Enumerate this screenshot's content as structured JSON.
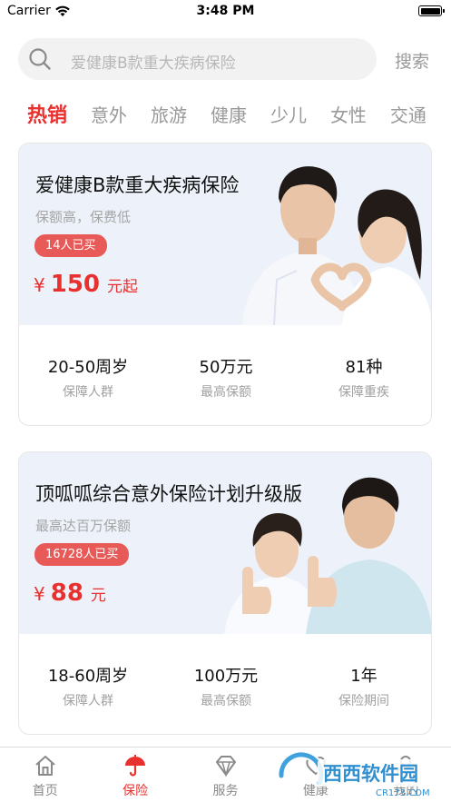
{
  "status_bar": {
    "carrier": "Carrier",
    "time": "3:48 PM"
  },
  "search": {
    "placeholder": "爱健康B款重大疾病保险",
    "button_label": "搜索"
  },
  "tabs": [
    {
      "label": "热销",
      "active": true
    },
    {
      "label": "意外"
    },
    {
      "label": "旅游"
    },
    {
      "label": "健康"
    },
    {
      "label": "少儿"
    },
    {
      "label": "女性"
    },
    {
      "label": "交通"
    }
  ],
  "products": [
    {
      "title": "爱健康B款重大疾病保险",
      "subtitle": "保额高，保费低",
      "buyers": "14人已买",
      "price_currency": "¥",
      "price_amount": "150",
      "price_suffix": "元起",
      "stats": [
        {
          "value": "20-50周岁",
          "label": "保障人群"
        },
        {
          "value": "50万元",
          "label": "最高保额"
        },
        {
          "value": "81种",
          "label": "保障重疾"
        }
      ]
    },
    {
      "title": "顶呱呱综合意外保险计划升级版",
      "subtitle": "最高达百万保额",
      "buyers": "16728人已买",
      "price_currency": "¥",
      "price_amount": "88",
      "price_suffix": "元",
      "stats": [
        {
          "value": "18-60周岁",
          "label": "保障人群"
        },
        {
          "value": "100万元",
          "label": "最高保额"
        },
        {
          "value": "1年",
          "label": "保险期间"
        }
      ]
    }
  ],
  "bottom_nav": [
    {
      "label": "首页",
      "icon": "home-icon"
    },
    {
      "label": "保险",
      "icon": "umbrella-icon",
      "active": true
    },
    {
      "label": "服务",
      "icon": "diamond-icon"
    },
    {
      "label": "健康",
      "icon": "heart-icon"
    },
    {
      "label": "我的",
      "icon": "person-icon"
    }
  ],
  "watermark": {
    "text": "西西软件园",
    "url_text": "CR173.COM"
  },
  "colors": {
    "accent": "#e8302e",
    "badge": "#e85a57",
    "card_header": "#edf2fa"
  }
}
